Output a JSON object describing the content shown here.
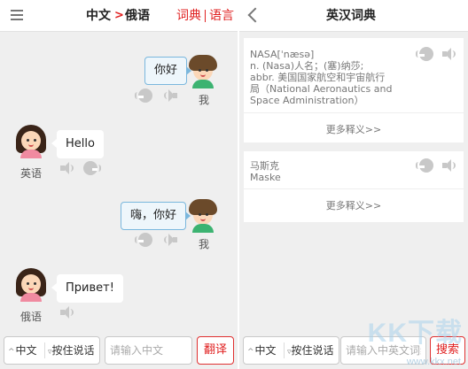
{
  "translator": {
    "header": {
      "lang_from": "中文",
      "lang_arrow": ">",
      "lang_to": "俄语",
      "nav_dict": "词典",
      "nav_lang": "语言"
    },
    "messages": [
      {
        "side": "me",
        "text": "你好",
        "speaker_label": "我"
      },
      {
        "side": "other",
        "text": "Hello",
        "speaker_label": "英语"
      },
      {
        "side": "me",
        "text": "嗨，你好",
        "speaker_label": "我"
      },
      {
        "side": "other",
        "text": "Привет!",
        "speaker_label": "俄语"
      }
    ],
    "bottom": {
      "mode_lang": "中文",
      "mic_label": "按住说话",
      "input_placeholder": "请输入中文",
      "translate_label": "翻译"
    }
  },
  "dictionary": {
    "title": "英汉词典",
    "entries": [
      {
        "lines": [
          "NASA[ˈnæsə]",
          "n. (Nasa)人名；(塞)纳莎;",
          "abbr. 美国国家航空和宇宙航行",
          "局（National Aeronautics and",
          "Space Administration）"
        ],
        "more": "更多释义>>"
      },
      {
        "lines": [
          "马斯克",
          "Maske"
        ],
        "more": "更多释义>>"
      }
    ],
    "bottom": {
      "mode_lang": "中文",
      "mic_label": "按住说话",
      "input_placeholder": "请输入中英文词组",
      "search_label": "搜索"
    }
  },
  "watermark": {
    "logo": "KK下载",
    "url": "www.kkx.net"
  },
  "colors": {
    "accent": "#e02020",
    "bubble_border": "#7ab7dd",
    "background": "#efefef"
  }
}
